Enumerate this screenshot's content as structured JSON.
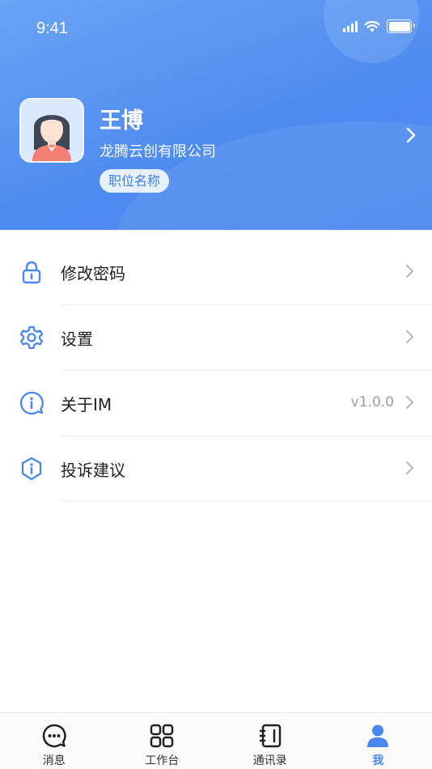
{
  "status_bar": {
    "time": "9:41"
  },
  "profile": {
    "name": "王博",
    "company": "龙腾云创有限公司",
    "position": "职位名称"
  },
  "menu": {
    "items": [
      {
        "label": "修改密码",
        "icon": "lock-icon",
        "value": ""
      },
      {
        "label": "设置",
        "icon": "gear-icon",
        "value": ""
      },
      {
        "label": "关于IM",
        "icon": "info-chat-icon",
        "value": "v1.0.0"
      },
      {
        "label": "投诉建议",
        "icon": "shield-info-icon",
        "value": ""
      }
    ]
  },
  "tabbar": {
    "items": [
      {
        "label": "消息",
        "icon": "chat-bubble-icon",
        "active": false
      },
      {
        "label": "工作台",
        "icon": "grid-icon",
        "active": false
      },
      {
        "label": "通讯录",
        "icon": "contacts-book-icon",
        "active": false
      },
      {
        "label": "我",
        "icon": "person-icon",
        "active": true
      }
    ]
  },
  "colors": {
    "accent": "#4a88ef",
    "header_start": "#6aa4f6",
    "header_end": "#4a86ee",
    "badge_bg": "#e6f0ff"
  }
}
